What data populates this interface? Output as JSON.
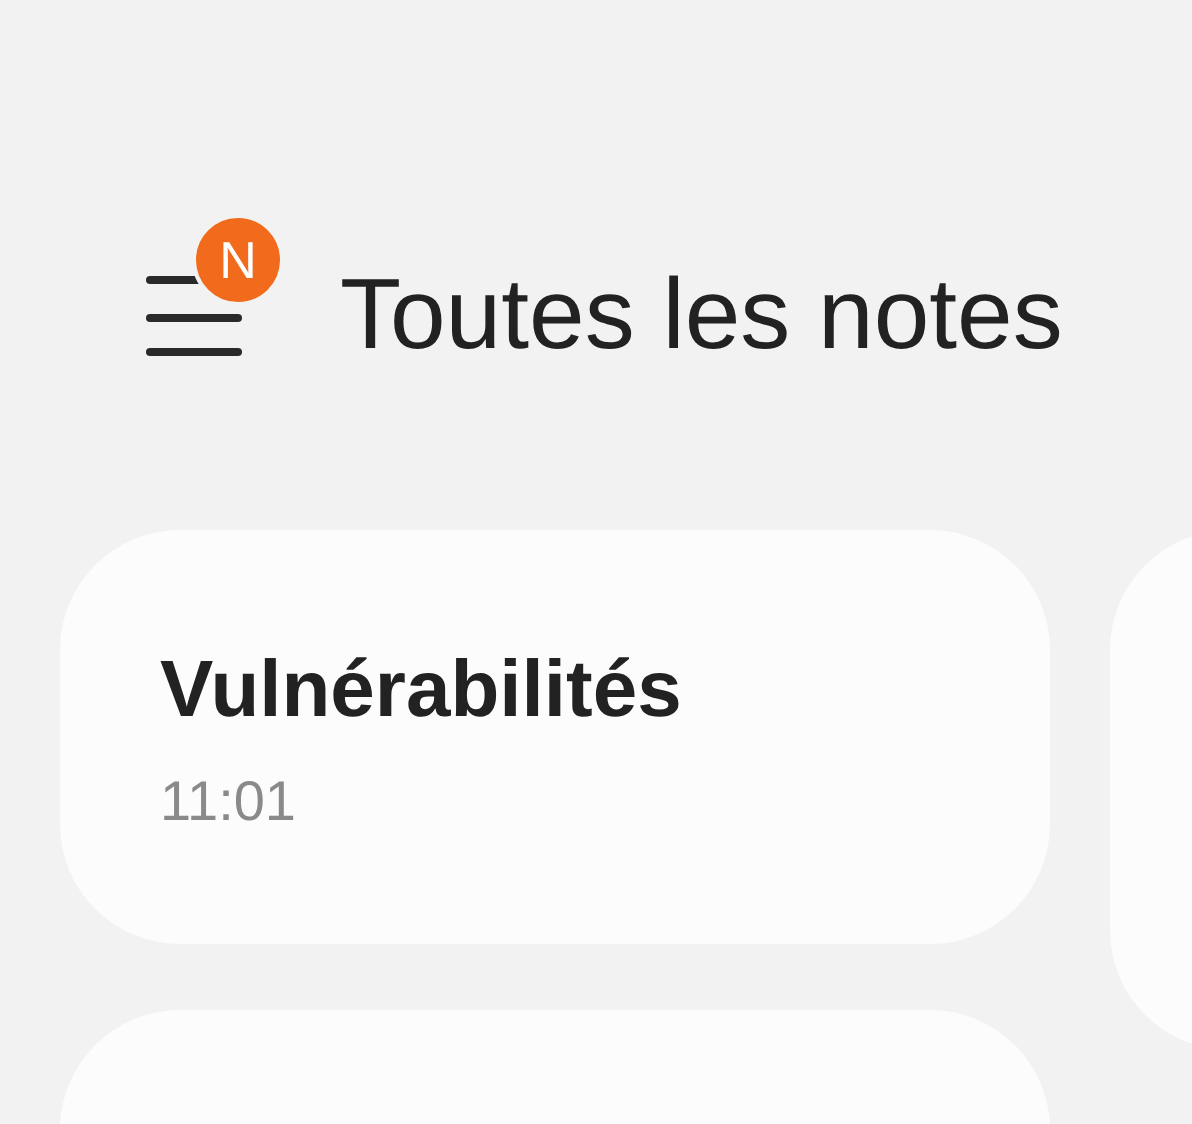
{
  "header": {
    "badge": "N",
    "title": "Toutes les notes"
  },
  "notes": [
    {
      "title": "Vulnérabilités",
      "time": "11:01"
    }
  ]
}
